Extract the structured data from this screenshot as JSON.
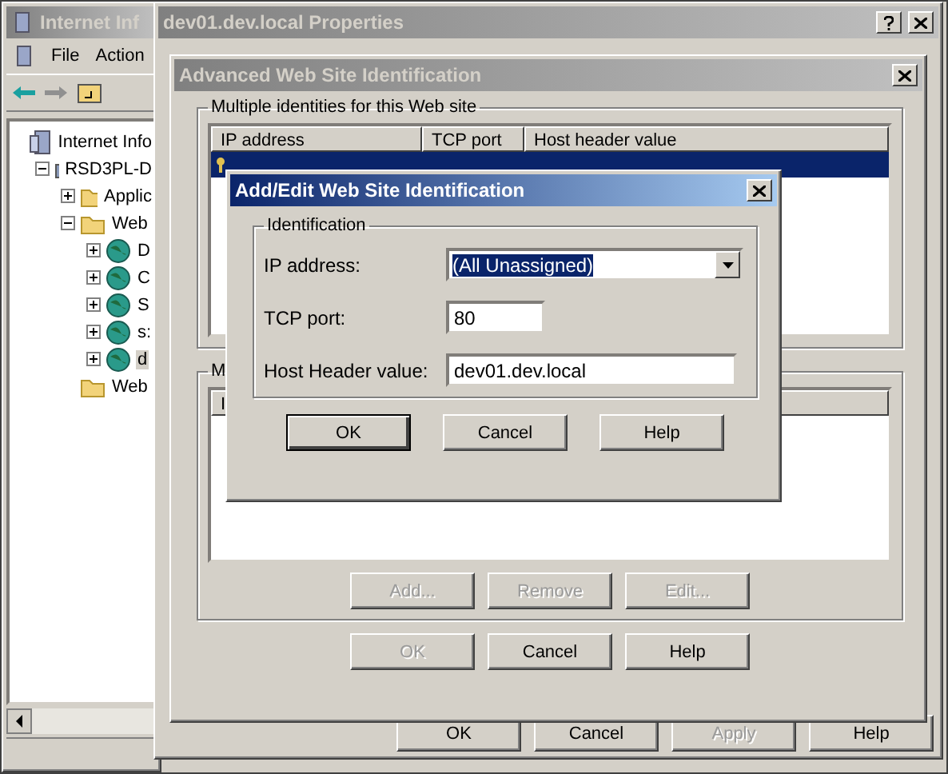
{
  "mmc": {
    "title": "Internet Inf",
    "menu": [
      "File",
      "Action"
    ],
    "tree": [
      {
        "label": "Internet Info",
        "kind": "iis",
        "selected": false,
        "children": [
          {
            "label": "RSD3PL-D",
            "kind": "server",
            "expanded": true,
            "selected": false,
            "children": [
              {
                "label": "Applic",
                "kind": "folder",
                "expanded": false,
                "selected": false
              },
              {
                "label": "Web",
                "kind": "folder",
                "expanded": true,
                "selected": false,
                "children": [
                  {
                    "label": "D",
                    "kind": "site",
                    "expanded": false,
                    "selected": false
                  },
                  {
                    "label": "C",
                    "kind": "site",
                    "expanded": false,
                    "selected": false
                  },
                  {
                    "label": "S",
                    "kind": "site",
                    "expanded": false,
                    "selected": false
                  },
                  {
                    "label": "s:",
                    "kind": "site",
                    "expanded": false,
                    "selected": false
                  },
                  {
                    "label": "d",
                    "kind": "site",
                    "expanded": false,
                    "selected": true
                  }
                ]
              },
              {
                "label": "Web",
                "kind": "folder",
                "selected": false
              }
            ]
          }
        ]
      }
    ]
  },
  "properties": {
    "title": "dev01.dev.local Properties",
    "buttons": [
      {
        "label": "OK",
        "disabled": false
      },
      {
        "label": "Cancel",
        "disabled": false
      },
      {
        "label": "Apply",
        "disabled": true
      },
      {
        "label": "Help",
        "disabled": false
      }
    ]
  },
  "advanced": {
    "title": "Advanced Web Site Identification",
    "identities": {
      "label": "Multiple identities for this Web site",
      "columns": [
        "IP address",
        "TCP port",
        "Host header value"
      ],
      "rows": [
        {
          "selected": true
        }
      ]
    },
    "second_group": {
      "label": "M",
      "columns": [
        "I"
      ],
      "buttons": [
        {
          "label": "Add...",
          "disabled": true
        },
        {
          "label": "Remove",
          "disabled": true
        },
        {
          "label": "Edit...",
          "disabled": true
        }
      ]
    },
    "buttons": [
      {
        "label": "OK",
        "disabled": true
      },
      {
        "label": "Cancel",
        "disabled": false
      },
      {
        "label": "Help",
        "disabled": false
      }
    ]
  },
  "add_edit": {
    "title": "Add/Edit Web Site Identification",
    "group_label": "Identification",
    "fields": [
      {
        "kind": "select",
        "label": "IP address:",
        "value": "(All Unassigned)"
      },
      {
        "kind": "text",
        "label": "TCP port:",
        "value": "80"
      },
      {
        "kind": "text",
        "label": "Host Header value:",
        "value": "dev01.dev.local"
      }
    ],
    "buttons": [
      {
        "label": "OK",
        "default": true
      },
      {
        "label": "Cancel",
        "default": false
      },
      {
        "label": "Help",
        "default": false
      }
    ]
  }
}
